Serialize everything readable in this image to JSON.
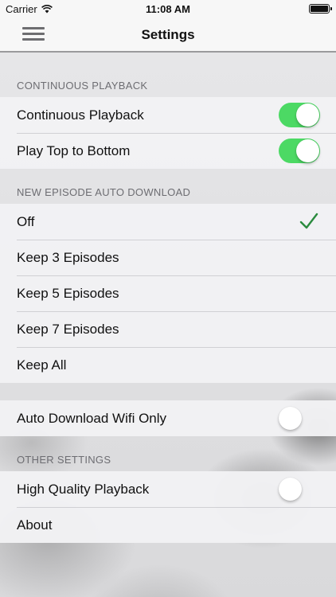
{
  "status_bar": {
    "carrier": "Carrier",
    "time": "11:08 AM",
    "wifi_icon": "wifi-icon",
    "battery_icon": "battery-icon"
  },
  "nav": {
    "title": "Settings",
    "menu_icon": "hamburger-menu-icon"
  },
  "sections": {
    "continuous": {
      "header": "CONTINUOUS PLAYBACK",
      "rows": [
        {
          "label": "Continuous Playback",
          "toggle": true
        },
        {
          "label": "Play Top to Bottom",
          "toggle": true
        }
      ]
    },
    "auto_download": {
      "header": "NEW EPISODE AUTO DOWNLOAD",
      "selected": "Off",
      "options": [
        "Off",
        "Keep 3 Episodes",
        "Keep 5 Episodes",
        "Keep 7 Episodes",
        "Keep All"
      ]
    },
    "wifi": {
      "rows": [
        {
          "label": "Auto Download Wifi Only",
          "toggle": false
        }
      ]
    },
    "other": {
      "header": "OTHER SETTINGS",
      "rows": [
        {
          "label": "High Quality Playback",
          "toggle": false
        },
        {
          "label": "About"
        }
      ]
    }
  },
  "colors": {
    "toggle_on": "#4cd964",
    "checkmark": "#2a8a3e",
    "section_header_text": "#6d6d72"
  }
}
